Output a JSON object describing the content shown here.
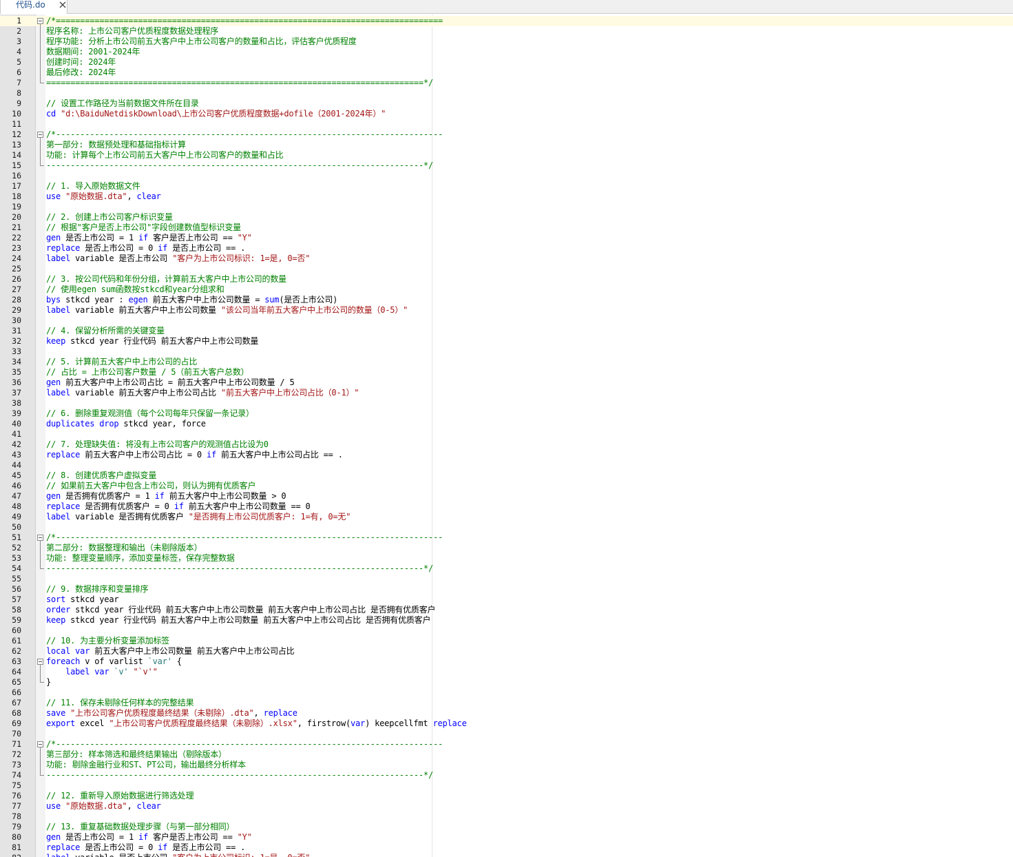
{
  "tab": {
    "filename": "代码.do",
    "close_label": "close"
  },
  "lines": [
    [
      [
        "c",
        "/*================================================================================"
      ]
    ],
    [
      [
        "c",
        "程序名称: 上市公司客户优质程度数据处理程序"
      ]
    ],
    [
      [
        "c",
        "程序功能: 分析上市公司前五大客户中上市公司客户的数量和占比，评估客户优质程度"
      ]
    ],
    [
      [
        "c",
        "数据期间: 2001-2024年"
      ]
    ],
    [
      [
        "c",
        "创建时间: 2024年"
      ]
    ],
    [
      [
        "c",
        "最后修改: 2024年"
      ]
    ],
    [
      [
        "c",
        "==============================================================================*/"
      ]
    ],
    [],
    [
      [
        "c",
        "// 设置工作路径为当前数据文件所在目录"
      ]
    ],
    [
      [
        "k",
        "cd"
      ],
      [
        "n",
        " "
      ],
      [
        "s",
        "\"d:\\BaiduNetdiskDownload\\上市公司客户优质程度数据+dofile（2001-2024年）\""
      ]
    ],
    [],
    [
      [
        "c",
        "/*--------------------------------------------------------------------------------"
      ]
    ],
    [
      [
        "c",
        "第一部分: 数据预处理和基础指标计算"
      ]
    ],
    [
      [
        "c",
        "功能: 计算每个上市公司前五大客户中上市公司客户的数量和占比"
      ]
    ],
    [
      [
        "c",
        "------------------------------------------------------------------------------*/"
      ]
    ],
    [],
    [
      [
        "c",
        "// 1. 导入原始数据文件"
      ]
    ],
    [
      [
        "k",
        "use"
      ],
      [
        "n",
        " "
      ],
      [
        "s",
        "\"原始数据.dta\""
      ],
      [
        "n",
        ", "
      ],
      [
        "k",
        "clear"
      ]
    ],
    [],
    [
      [
        "c",
        "// 2. 创建上市公司客户标识变量"
      ]
    ],
    [
      [
        "c",
        "// 根据\"客户是否上市公司\"字段创建数值型标识变量"
      ]
    ],
    [
      [
        "k",
        "gen"
      ],
      [
        "n",
        " 是否上市公司 = 1 "
      ],
      [
        "k",
        "if"
      ],
      [
        "n",
        " 客户是否上市公司 == "
      ],
      [
        "s",
        "\"Y\""
      ]
    ],
    [
      [
        "k",
        "replace"
      ],
      [
        "n",
        " 是否上市公司 = 0 "
      ],
      [
        "k",
        "if"
      ],
      [
        "n",
        " 是否上市公司 == ."
      ]
    ],
    [
      [
        "k",
        "label"
      ],
      [
        "n",
        " variable 是否上市公司 "
      ],
      [
        "s",
        "\"客户为上市公司标识: 1=是, 0=否\""
      ]
    ],
    [],
    [
      [
        "c",
        "// 3. 按公司代码和年份分组，计算前五大客户中上市公司的数量"
      ]
    ],
    [
      [
        "c",
        "// 使用egen sum函数按stkcd和year分组求和"
      ]
    ],
    [
      [
        "k",
        "bys"
      ],
      [
        "n",
        " stkcd year : "
      ],
      [
        "k",
        "egen"
      ],
      [
        "n",
        " 前五大客户中上市公司数量 = "
      ],
      [
        "k",
        "sum"
      ],
      [
        "n",
        "(是否上市公司)"
      ]
    ],
    [
      [
        "k",
        "label"
      ],
      [
        "n",
        " variable 前五大客户中上市公司数量 "
      ],
      [
        "s",
        "\"该公司当年前五大客户中上市公司的数量（0-5）\""
      ]
    ],
    [],
    [
      [
        "c",
        "// 4. 保留分析所需的关键变量"
      ]
    ],
    [
      [
        "k",
        "keep"
      ],
      [
        "n",
        " stkcd year 行业代码 前五大客户中上市公司数量"
      ]
    ],
    [],
    [
      [
        "c",
        "// 5. 计算前五大客户中上市公司的占比"
      ]
    ],
    [
      [
        "c",
        "// 占比 = 上市公司客户数量 / 5（前五大客户总数）"
      ]
    ],
    [
      [
        "k",
        "gen"
      ],
      [
        "n",
        " 前五大客户中上市公司占比 = 前五大客户中上市公司数量 / 5"
      ]
    ],
    [
      [
        "k",
        "label"
      ],
      [
        "n",
        " variable 前五大客户中上市公司占比 "
      ],
      [
        "s",
        "\"前五大客户中上市公司占比（0-1）\""
      ]
    ],
    [],
    [
      [
        "c",
        "// 6. 删除重复观测值（每个公司每年只保留一条记录）"
      ]
    ],
    [
      [
        "k",
        "duplicates"
      ],
      [
        "n",
        " "
      ],
      [
        "k",
        "drop"
      ],
      [
        "n",
        " stkcd year, force"
      ]
    ],
    [],
    [
      [
        "c",
        "// 7. 处理缺失值: 将没有上市公司客户的观测值占比设为0"
      ]
    ],
    [
      [
        "k",
        "replace"
      ],
      [
        "n",
        " 前五大客户中上市公司占比 = 0 "
      ],
      [
        "k",
        "if"
      ],
      [
        "n",
        " 前五大客户中上市公司占比 == ."
      ]
    ],
    [],
    [
      [
        "c",
        "// 8. 创建优质客户虚拟变量"
      ]
    ],
    [
      [
        "c",
        "// 如果前五大客户中包含上市公司，则认为拥有优质客户"
      ]
    ],
    [
      [
        "k",
        "gen"
      ],
      [
        "n",
        " 是否拥有优质客户 = 1 "
      ],
      [
        "k",
        "if"
      ],
      [
        "n",
        " 前五大客户中上市公司数量 > 0"
      ]
    ],
    [
      [
        "k",
        "replace"
      ],
      [
        "n",
        " 是否拥有优质客户 = 0 "
      ],
      [
        "k",
        "if"
      ],
      [
        "n",
        " 前五大客户中上市公司数量 == 0"
      ]
    ],
    [
      [
        "k",
        "label"
      ],
      [
        "n",
        " variable 是否拥有优质客户 "
      ],
      [
        "s",
        "\"是否拥有上市公司优质客户: 1=有, 0=无\""
      ]
    ],
    [],
    [
      [
        "c",
        "/*--------------------------------------------------------------------------------"
      ]
    ],
    [
      [
        "c",
        "第二部分: 数据整理和输出（未剔除版本）"
      ]
    ],
    [
      [
        "c",
        "功能: 整理变量顺序，添加变量标签，保存完整数据"
      ]
    ],
    [
      [
        "c",
        "------------------------------------------------------------------------------*/"
      ]
    ],
    [],
    [
      [
        "c",
        "// 9. 数据排序和变量排序"
      ]
    ],
    [
      [
        "k",
        "sort"
      ],
      [
        "n",
        " stkcd year"
      ]
    ],
    [
      [
        "k",
        "order"
      ],
      [
        "n",
        " stkcd year 行业代码 前五大客户中上市公司数量 前五大客户中上市公司占比 是否拥有优质客户"
      ]
    ],
    [
      [
        "k",
        "keep"
      ],
      [
        "n",
        " stkcd year 行业代码 前五大客户中上市公司数量 前五大客户中上市公司占比 是否拥有优质客户"
      ]
    ],
    [],
    [
      [
        "c",
        "// 10. 为主要分析变量添加标签"
      ]
    ],
    [
      [
        "k",
        "local"
      ],
      [
        "n",
        " "
      ],
      [
        "k",
        "var"
      ],
      [
        "n",
        " 前五大客户中上市公司数量 前五大客户中上市公司占比"
      ]
    ],
    [
      [
        "k",
        "foreach"
      ],
      [
        "n",
        " v of varlist "
      ],
      [
        "m",
        "`var'"
      ],
      [
        "n",
        " {"
      ]
    ],
    [
      [
        "n",
        "    "
      ],
      [
        "k",
        "label"
      ],
      [
        "n",
        " "
      ],
      [
        "k",
        "var"
      ],
      [
        "n",
        " "
      ],
      [
        "m",
        "`v'"
      ],
      [
        "n",
        " "
      ],
      [
        "s",
        "\"`v'\""
      ]
    ],
    [
      [
        "n",
        "}"
      ]
    ],
    [],
    [
      [
        "c",
        "// 11. 保存未剔除任何样本的完整结果"
      ]
    ],
    [
      [
        "k",
        "save"
      ],
      [
        "n",
        " "
      ],
      [
        "s",
        "\"上市公司客户优质程度最终结果（未剔除）.dta\""
      ],
      [
        "n",
        ", "
      ],
      [
        "k",
        "replace"
      ]
    ],
    [
      [
        "k",
        "export"
      ],
      [
        "n",
        " excel "
      ],
      [
        "s",
        "\"上市公司客户优质程度最终结果（未剔除）.xlsx\""
      ],
      [
        "n",
        ", firstrow("
      ],
      [
        "k",
        "var"
      ],
      [
        "n",
        ") keepcellfmt "
      ],
      [
        "k",
        "replace"
      ]
    ],
    [],
    [
      [
        "c",
        "/*--------------------------------------------------------------------------------"
      ]
    ],
    [
      [
        "c",
        "第三部分: 样本筛选和最终结果输出（剔除版本）"
      ]
    ],
    [
      [
        "c",
        "功能: 剔除金融行业和ST、PT公司，输出最终分析样本"
      ]
    ],
    [
      [
        "c",
        "------------------------------------------------------------------------------*/"
      ]
    ],
    [],
    [
      [
        "c",
        "// 12. 重新导入原始数据进行筛选处理"
      ]
    ],
    [
      [
        "k",
        "use"
      ],
      [
        "n",
        " "
      ],
      [
        "s",
        "\"原始数据.dta\""
      ],
      [
        "n",
        ", "
      ],
      [
        "k",
        "clear"
      ]
    ],
    [],
    [
      [
        "c",
        "// 13. 重复基础数据处理步骤（与第一部分相同）"
      ]
    ],
    [
      [
        "k",
        "gen"
      ],
      [
        "n",
        " 是否上市公司 = 1 "
      ],
      [
        "k",
        "if"
      ],
      [
        "n",
        " 客户是否上市公司 == "
      ],
      [
        "s",
        "\"Y\""
      ]
    ],
    [
      [
        "k",
        "replace"
      ],
      [
        "n",
        " 是否上市公司 = 0 "
      ],
      [
        "k",
        "if"
      ],
      [
        "n",
        " 是否上市公司 == ."
      ]
    ],
    [
      [
        "k",
        "label"
      ],
      [
        "n",
        " variable 是否上市公司 "
      ],
      [
        "s",
        "\"客户为上市公司标识: 1=是, 0=否\""
      ]
    ]
  ],
  "folds": [
    {
      "start": 1,
      "end": 7
    },
    {
      "start": 12,
      "end": 15
    },
    {
      "start": 51,
      "end": 54
    },
    {
      "start": 63,
      "end": 65
    },
    {
      "start": 71,
      "end": 74
    }
  ],
  "current_line": 1,
  "colors": {
    "comment": "#008000",
    "keyword": "#0000ff",
    "string": "#a31515",
    "macro": "#2a7a7a",
    "gutter": "#e4e4e4",
    "current_line": "#fffbe3",
    "tab_text": "#1c4f8c"
  }
}
